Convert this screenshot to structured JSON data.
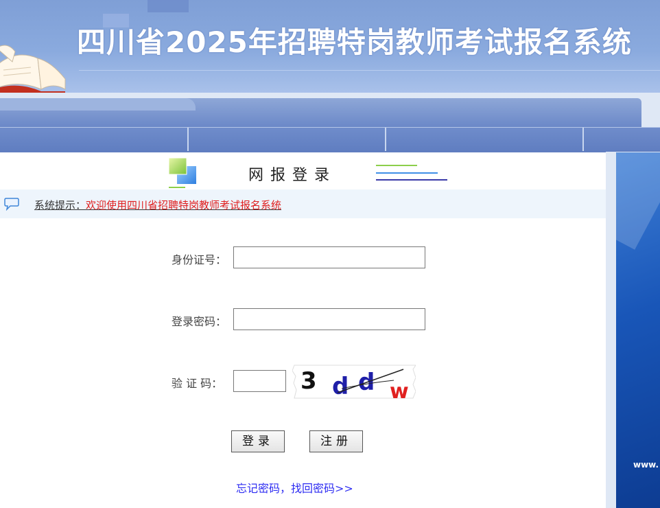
{
  "banner": {
    "title": "四川省2025年招聘特岗教师考试报名系统"
  },
  "header": {
    "title": "网报登录"
  },
  "notice": {
    "label": "系统提示：",
    "message": "欢迎使用四川省招聘特岗教师考试报名系统"
  },
  "form": {
    "id_label": "身份证号：",
    "id_value": "",
    "password_label": "登录密码：",
    "password_value": "",
    "captcha_label": "验 证 码：",
    "captcha_value": "",
    "captcha_text": "3ddw"
  },
  "buttons": {
    "login": "登录",
    "register": "注册"
  },
  "forgot_link": "忘记密码，找回密码>>",
  "side_banner": {
    "text": "www."
  },
  "colors": {
    "banner": "#8aaade",
    "nav": "#6f8ccb",
    "notice_text": "#e0201f",
    "link": "#2d2cf2"
  },
  "icons": [
    "book-icon",
    "login-cube-icon",
    "speech-bubble-icon"
  ]
}
